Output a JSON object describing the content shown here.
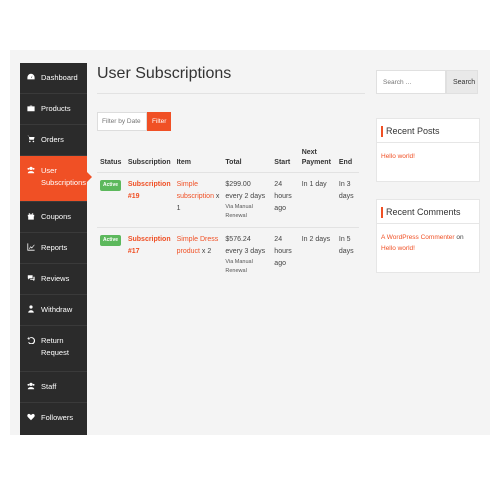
{
  "sidebar": {
    "items": [
      {
        "label": "Dashboard",
        "icon": "dashboard-icon"
      },
      {
        "label": "Products",
        "icon": "briefcase-icon"
      },
      {
        "label": "Orders",
        "icon": "cart-icon"
      },
      {
        "label": "User Subscriptions",
        "icon": "users-icon",
        "active": true
      },
      {
        "label": "Coupons",
        "icon": "gift-icon"
      },
      {
        "label": "Reports",
        "icon": "chart-icon"
      },
      {
        "label": "Reviews",
        "icon": "comments-icon"
      },
      {
        "label": "Withdraw",
        "icon": "upload-icon"
      },
      {
        "label": "Return Request",
        "icon": "undo-icon"
      },
      {
        "label": "Staff",
        "icon": "group-icon"
      },
      {
        "label": "Followers",
        "icon": "heart-icon"
      }
    ]
  },
  "main": {
    "title": "User Subscriptions",
    "filter": {
      "date_placeholder": "Filter by Date",
      "button_label": "Filter"
    },
    "table": {
      "headers": {
        "status": "Status",
        "subscription": "Subscription",
        "item": "Item",
        "total": "Total",
        "start": "Start",
        "next_payment": "Next Payment",
        "end": "End"
      },
      "rows": [
        {
          "status": "Active",
          "subscription": "Subscription #19",
          "item_name": "Simple subscription",
          "item_qty": "x 1",
          "total": "$299.00 every 2 days",
          "via": "Via Manual Renewal",
          "start": "24 hours ago",
          "next_payment": "In 1 day",
          "end": "In 3 days"
        },
        {
          "status": "Active",
          "subscription": "Subscription #17",
          "item_name": "Simple Dress product",
          "item_qty": "x 2",
          "total": "$576.24 every 3 days",
          "via": "Via Manual Renewal",
          "start": "24 hours ago",
          "next_payment": "In 2 days",
          "end": "In 5 days"
        }
      ]
    }
  },
  "right": {
    "search": {
      "placeholder": "Search …",
      "button_label": "Search"
    },
    "recent_posts": {
      "title": "Recent Posts",
      "items": [
        "Hello world!"
      ]
    },
    "recent_comments": {
      "title": "Recent Comments",
      "author": "A WordPress Commenter",
      "connector": "on",
      "post": "Hello world!"
    }
  },
  "colors": {
    "accent": "#f05025",
    "sidebar_bg": "#2b2b2b",
    "badge_active": "#5cb85c"
  }
}
